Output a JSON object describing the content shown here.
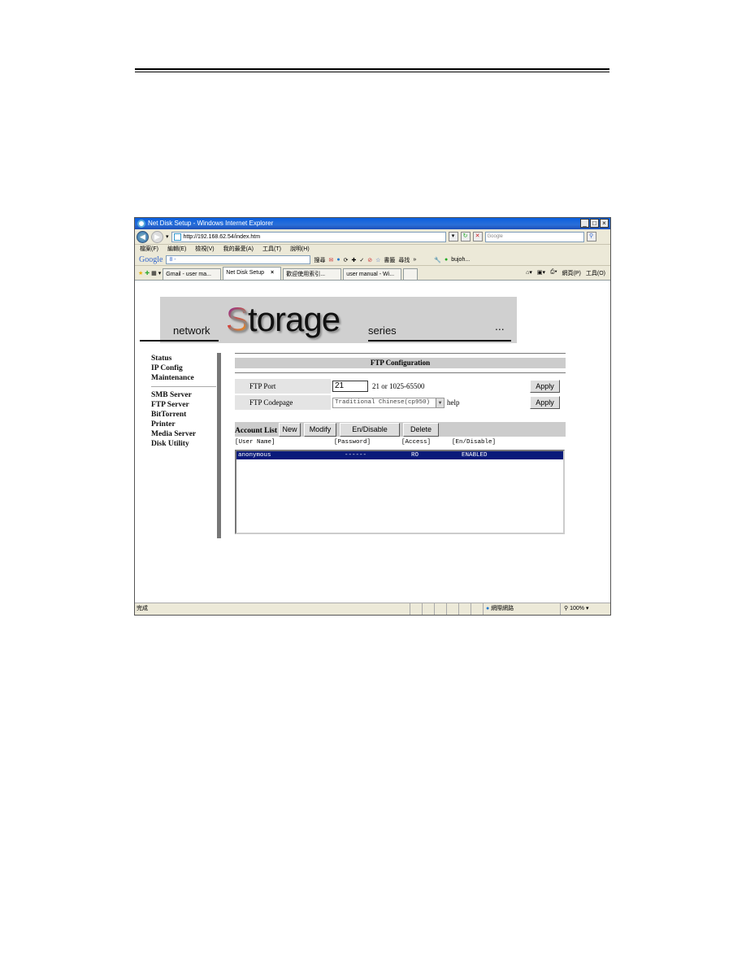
{
  "window": {
    "title": "Net Disk Setup - Windows Internet Explorer",
    "controls": [
      "_",
      "□",
      "×"
    ]
  },
  "addressbar": {
    "url": "http://192.168.62.54/index.htm",
    "search_placeholder": "Google"
  },
  "menubar": [
    "檔案(F)",
    "編輯(E)",
    "檢視(V)",
    "我的最愛(A)",
    "工具(T)",
    "說明(H)"
  ],
  "google_toolbar": {
    "logo": "Google",
    "input_value": "8 -",
    "search_label": "搜尋",
    "find_label": "尋找",
    "bookmarks_label": "書籤",
    "user_label": "bujoh..."
  },
  "tabs": [
    {
      "label": "Gmail - user ma...",
      "active": false
    },
    {
      "label": "Net Disk Setup",
      "active": true
    },
    {
      "label": "歡迎使用索引...",
      "active": false
    },
    {
      "label": "user manual - Wi...",
      "active": false
    }
  ],
  "tab_tools": {
    "page_label": "網頁(P)",
    "tools_label": "工具(O)"
  },
  "banner": {
    "network": "network",
    "storage_s": "S",
    "storage_rest": "torage",
    "series": "series",
    "dots": "..."
  },
  "sidenav": {
    "group1": [
      "Status",
      "IP Config",
      "Maintenance"
    ],
    "group2": [
      "SMB Server",
      "FTP Server",
      "BitTorrent",
      "Printer",
      "Media Server",
      "Disk Utility"
    ]
  },
  "ftp": {
    "section_title": "FTP Configuration",
    "port_label": "FTP Port",
    "port_value": "21",
    "port_hint": "21 or 1025-65500",
    "codepage_label": "FTP Codepage",
    "codepage_value": "Traditional Chinese(cp950)",
    "help_label": "help",
    "apply_label": "Apply"
  },
  "accounts": {
    "title": "Account List",
    "buttons": [
      "New",
      "Modify",
      "En/Disable",
      "Delete"
    ],
    "columns": [
      "[User Name]",
      "[Password]",
      "[Access]",
      "[En/Disable]"
    ],
    "rows": [
      {
        "user": "anonymous",
        "password": "------",
        "access": "RO",
        "status": "ENABLED"
      }
    ]
  },
  "statusbar": {
    "status": "完成",
    "zone": "網際網路",
    "zoom": "100%"
  }
}
